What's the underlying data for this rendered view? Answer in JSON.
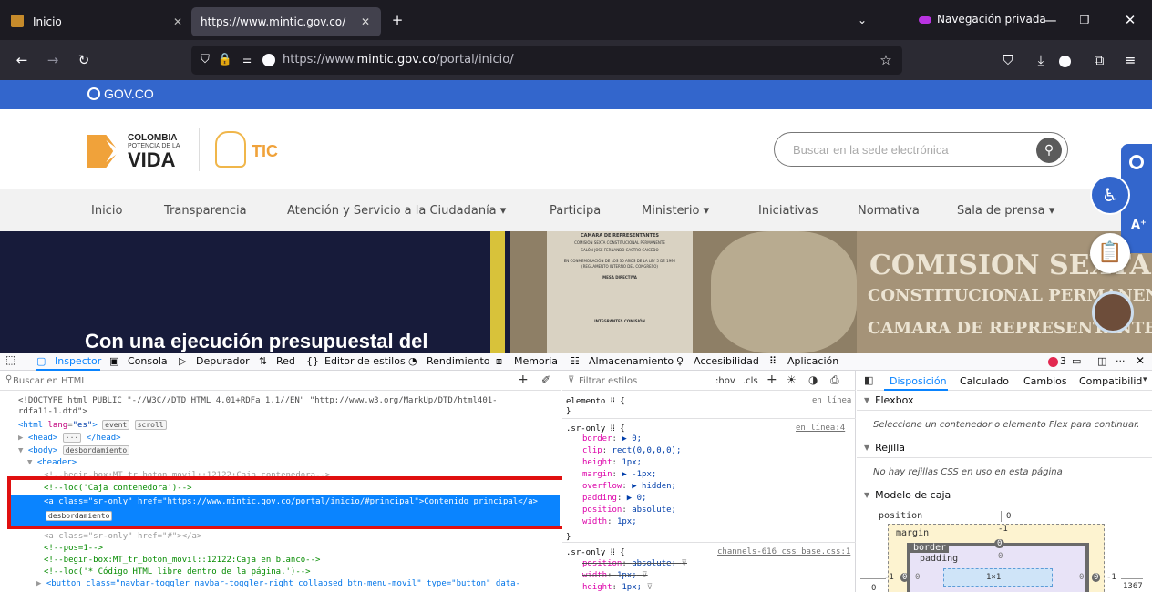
{
  "browser": {
    "tabs": [
      {
        "label": "Inicio"
      },
      {
        "label": "https://www.mintic.gov.co/portal/i"
      }
    ],
    "private_label": "Navegación privada",
    "url_prefix": "https://www.",
    "url_domain": "mintic.gov.co",
    "url_path": "/portal/inicio/"
  },
  "site": {
    "gov_label": "GOV.CO",
    "logo_top": "COLOMBIA",
    "logo_sub": "POTENCIA DE LA",
    "logo_main": "VIDA",
    "tic_label": "TIC",
    "search_placeholder": "Buscar en la sede electrónica",
    "nav": [
      {
        "label": "Inicio"
      },
      {
        "label": "Transparencia"
      },
      {
        "label": "Atención y Servicio a la Ciudadanía ▾"
      },
      {
        "label": "Participa"
      },
      {
        "label": "Ministerio ▾"
      },
      {
        "label": "Iniciativas"
      },
      {
        "label": "Normativa"
      },
      {
        "label": "Sala de prensa ▾"
      }
    ],
    "hero_title": "Con una ejecución presupuestal del",
    "plaque_title": "CAMARA DE REPRESENTANTES",
    "plaque_lines": [
      "COMISIÓN SEXTA CONSTITUCIONAL PERMANENTE",
      "SALÓN JOSÉ FERNANDO CASTRO CAICEDO",
      "EN CONMEMORACIÓN DE LOS 30 AÑOS DE LA LEY 5 DE 1992",
      "(REGLAMENTO INTERNO DEL CONGRESO)",
      "MESA DIRECTIVA",
      "INTEGRANTES COMISIÓN"
    ],
    "wall_lines": [
      "COMISION SEXTA",
      "CONSTITUCIONAL PERMANENTE",
      "CAMARA DE REPRESENTANTES"
    ]
  },
  "devtools": {
    "tabs": [
      {
        "label": "Inspector"
      },
      {
        "label": "Consola"
      },
      {
        "label": "Depurador"
      },
      {
        "label": "Red"
      },
      {
        "label": "Editor de estilos"
      },
      {
        "label": "Rendimiento"
      },
      {
        "label": "Memoria"
      },
      {
        "label": "Almacenamiento"
      },
      {
        "label": "Accesibilidad"
      },
      {
        "label": "Aplicación"
      }
    ],
    "error_count": "3",
    "search_html_placeholder": "Buscar en HTML",
    "filter_styles_placeholder": "Filtrar estilos",
    "hov": ":hov",
    "cls": ".cls",
    "html_lines": {
      "l1": "<!DOCTYPE html PUBLIC \"-//W3C//DTD HTML 4.01+RDFa 1.1//EN\" \"http://www.w3.org/MarkUp/DTD/html401-",
      "l2": "rdfa11-1.dtd\">",
      "l3_open": "<html",
      "l3_attr": "lang",
      "l3_val": "\"es\"",
      "l3_close": ">",
      "badge_event": "event",
      "badge_scroll": "scroll",
      "head": "<head>",
      "head_close": "</head>",
      "body": "<body>",
      "badge_overflow": "desbordamiento",
      "header": "<header>",
      "hidden_line": "<!--begin-box:MT_tr_boton_movil::12122:Caja contenedora-->",
      "comment_caja": "<!--loc('Caja contenedora')-->",
      "a_open": "<a",
      "a_class_attr": "class",
      "a_class_val": "\"sr-only\"",
      "a_href_attr": "href",
      "a_href_val": "\"https://www.mintic.gov.co/portal/inicio/#principal\"",
      "a_text": ">Contenido principal</a>",
      "badge_overflow2": "desbordamiento",
      "hidden_line2": "<a class=\"sr-only\" href=\"#\"></a>",
      "comment_pos": "<!--pos=1-->",
      "comment_begin": "<!--begin-box:MT_tr_boton_movil::12122:Caja en blanco-->",
      "comment_loc": "<!--loc('* Código HTML libre dentro de la página.')-->",
      "button_line": "<button class=\"navbar-toggler navbar-toggler-right collapsed btn-menu-movil\" type=\"button\" data-"
    },
    "rules": {
      "elemento": "elemento",
      "en_linea": "en línea",
      "sr_only": ".sr-only",
      "en_linea4": "en línea:4",
      "props": [
        {
          "p": "border",
          "v": "▶ 0;"
        },
        {
          "p": "clip",
          "v": "rect(0,0,0,0);"
        },
        {
          "p": "height",
          "v": "1px;"
        },
        {
          "p": "margin",
          "v": "▶ -1px;"
        },
        {
          "p": "overflow",
          "v": "▶ hidden;"
        },
        {
          "p": "padding",
          "v": "▶ 0;"
        },
        {
          "p": "position",
          "v": "absolute;"
        },
        {
          "p": "width",
          "v": "1px;"
        }
      ],
      "source2": "channels-616_css_base.css:1",
      "struck": [
        {
          "p": "position",
          "v": "absolute;"
        },
        {
          "p": "width",
          "v": "1px;"
        },
        {
          "p": "height",
          "v": "1px;"
        }
      ]
    },
    "right_tabs": [
      {
        "label": "Disposición"
      },
      {
        "label": "Calculado"
      },
      {
        "label": "Cambios"
      },
      {
        "label": "Compatibilid"
      }
    ],
    "layout": {
      "flexbox": "Flexbox",
      "flex_msg": "Seleccione un contenedor o elemento Flex para continuar.",
      "grid": "Rejilla",
      "grid_msg": "No hay rejillas CSS en uso en esta página",
      "box_model": "Modelo de caja",
      "position": "position",
      "pos_val": "0",
      "margin": "margin",
      "margin_val": "-1",
      "border": "border",
      "border_val": "0",
      "padding": "padding",
      "padding_val": "0",
      "content": "1×1",
      "left_vals": [
        "-1",
        "0",
        "0"
      ],
      "right_vals": [
        "0",
        "0",
        "-1"
      ],
      "far_left": "0",
      "far_right": "1367"
    }
  }
}
